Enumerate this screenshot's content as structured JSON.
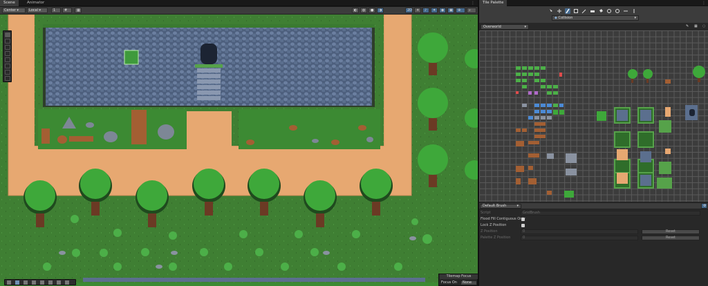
{
  "scene_window": {
    "tabs": [
      {
        "label": "Scene"
      },
      {
        "label": "Animator"
      }
    ],
    "toolbar": {
      "center_label": "Center",
      "local_label": "Local",
      "snap_value": "1",
      "mode_2d_label": "2D"
    },
    "overlay": {
      "title": "Tilemap Focus",
      "focus_label": "Focus On",
      "focus_value": "None"
    }
  },
  "palette_window": {
    "tab_label": "Tile Palette",
    "active_tilemap": "Collision",
    "palette_name": "Overworld",
    "brush_name": "Default Brush",
    "fields": {
      "script_label": "Script",
      "script_value": "GridBrush",
      "flood_fill_label": "Flood Fill Contiguous Only",
      "lock_z_label": "Lock Z Position",
      "z_position_label": "Z Position",
      "palette_z_label": "Palette Z Position",
      "zero_value": "0",
      "reset_label": "Reset"
    }
  },
  "colors": {
    "editor_bg": "#282828",
    "toolbar_bg": "#3c3c3c",
    "grass": "#3f7f33",
    "dirt": "#e7a871",
    "stone_wall": "#5b6f8e",
    "tree_canopy": "#3ea83a",
    "trunk": "#6b3a24",
    "highlight_blue": "#466a8e"
  },
  "icons": [
    "hand-icon",
    "move-icon",
    "rotate-icon",
    "scale-icon",
    "rect-icon",
    "transform-icon",
    "custom-tool-icon",
    "paint-brush-icon",
    "select-icon",
    "eyedropper-icon",
    "eraser-icon",
    "box-fill-icon",
    "fill-bucket-icon",
    "pan-icon",
    "grid-icon",
    "settings-icon",
    "kebab-menu-icon",
    "lighting-icon",
    "audio-icon",
    "fx-icon",
    "camera-icon",
    "gizmo-icon"
  ]
}
